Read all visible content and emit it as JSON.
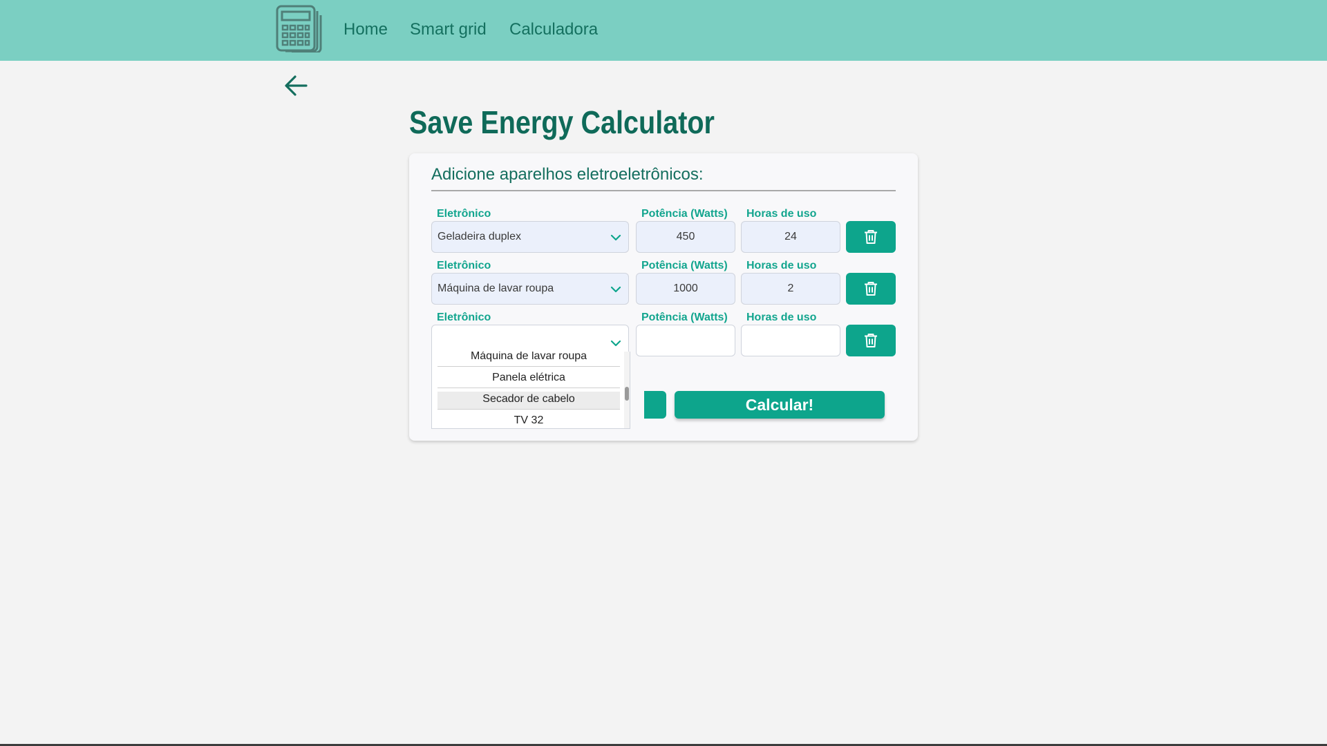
{
  "nav": {
    "logo_icon": "calculator-icon",
    "links": [
      "Home",
      "Smart grid",
      "Calculadora"
    ]
  },
  "back_icon": "arrow-left-icon",
  "title": "Save Energy Calculator",
  "card": {
    "heading": "Adicione aparelhos eletroeletrônicos:",
    "rows": [
      {
        "device_label": "Eletrônico",
        "device_value": "Geladeira duplex",
        "power_label": "Potência (Watts)",
        "power_value": "450",
        "hours_label": "Horas de uso",
        "hours_value": "24"
      },
      {
        "device_label": "Eletrônico",
        "device_value": "Máquina de lavar roupa",
        "power_label": "Potência (Watts)",
        "power_value": "1000",
        "hours_label": "Horas de uso",
        "hours_value": "2"
      },
      {
        "device_label": "Eletrônico",
        "device_value": "",
        "power_label": "Potência (Watts)",
        "power_value": "",
        "hours_label": "Horas de uso",
        "hours_value": ""
      }
    ],
    "delete_icon": "trash-icon",
    "calculate_label": "Calcular!"
  },
  "dropdown": {
    "options": [
      "Máquina de lavar roupa",
      "Panela elétrica",
      "Secador de cabelo",
      "TV 32"
    ],
    "highlighted": "Secador de cabelo"
  },
  "colors": {
    "navbar": "#7bcfc2",
    "accent": "#0da58c",
    "title": "#0f6a59",
    "label": "#12a58e",
    "background": "#f3f3f3"
  }
}
